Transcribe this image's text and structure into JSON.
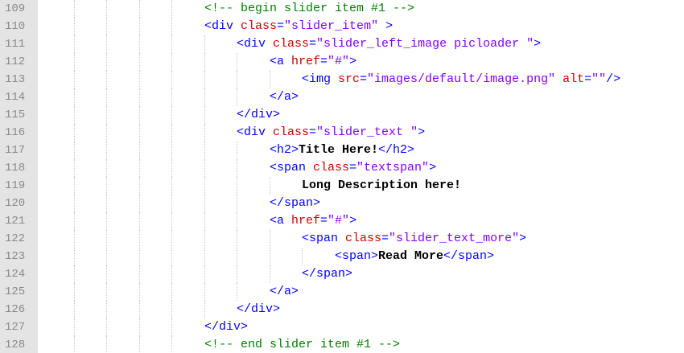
{
  "editor": {
    "language": "html",
    "colors": {
      "gutter_bg": "#e4e4e4",
      "line_number": "#8a8a8a",
      "comment": "#008000",
      "tag": "#0000ff",
      "attribute": "#cc0000",
      "string": "#8000ff",
      "text": "#000000",
      "indent_guide": "#c8c8c8"
    },
    "lines": [
      {
        "number": "109",
        "indent": 5,
        "tokens": [
          {
            "t": "comment",
            "v": "<!-- begin slider item #1 -->"
          }
        ]
      },
      {
        "number": "110",
        "indent": 5,
        "tokens": [
          {
            "t": "tag",
            "v": "<div "
          },
          {
            "t": "attr",
            "v": "class"
          },
          {
            "t": "tag",
            "v": "="
          },
          {
            "t": "str",
            "v": "\"slider_item\""
          },
          {
            "t": "tag",
            "v": " >"
          }
        ]
      },
      {
        "number": "111",
        "indent": 6,
        "tokens": [
          {
            "t": "tag",
            "v": "<div "
          },
          {
            "t": "attr",
            "v": "class"
          },
          {
            "t": "tag",
            "v": "="
          },
          {
            "t": "str",
            "v": "\"slider_left_image picloader \""
          },
          {
            "t": "tag",
            "v": ">"
          }
        ]
      },
      {
        "number": "112",
        "indent": 7,
        "tokens": [
          {
            "t": "tag",
            "v": "<a "
          },
          {
            "t": "attr",
            "v": "href"
          },
          {
            "t": "tag",
            "v": "="
          },
          {
            "t": "str",
            "v": "\"#\""
          },
          {
            "t": "tag",
            "v": ">"
          }
        ]
      },
      {
        "number": "113",
        "indent": 8,
        "tokens": [
          {
            "t": "tag",
            "v": "<img "
          },
          {
            "t": "attr",
            "v": "src"
          },
          {
            "t": "tag",
            "v": "="
          },
          {
            "t": "str",
            "v": "\"images/default/image.png\""
          },
          {
            "t": "tag",
            "v": " "
          },
          {
            "t": "attr",
            "v": "alt"
          },
          {
            "t": "tag",
            "v": "="
          },
          {
            "t": "str",
            "v": "\"\""
          },
          {
            "t": "tag",
            "v": "/>"
          }
        ]
      },
      {
        "number": "114",
        "indent": 7,
        "tokens": [
          {
            "t": "tag",
            "v": "</a>"
          }
        ]
      },
      {
        "number": "115",
        "indent": 6,
        "tokens": [
          {
            "t": "tag",
            "v": "</div>"
          }
        ]
      },
      {
        "number": "116",
        "indent": 6,
        "tokens": [
          {
            "t": "tag",
            "v": "<div "
          },
          {
            "t": "attr",
            "v": "class"
          },
          {
            "t": "tag",
            "v": "="
          },
          {
            "t": "str",
            "v": "\"slider_text \""
          },
          {
            "t": "tag",
            "v": ">"
          }
        ]
      },
      {
        "number": "117",
        "indent": 7,
        "tokens": [
          {
            "t": "tag",
            "v": "<h2>"
          },
          {
            "t": "text",
            "v": "Title Here!"
          },
          {
            "t": "tag",
            "v": "</h2>"
          }
        ]
      },
      {
        "number": "118",
        "indent": 7,
        "tokens": [
          {
            "t": "tag",
            "v": "<span "
          },
          {
            "t": "attr",
            "v": "class"
          },
          {
            "t": "tag",
            "v": "="
          },
          {
            "t": "str",
            "v": "\"textspan\""
          },
          {
            "t": "tag",
            "v": ">"
          }
        ]
      },
      {
        "number": "119",
        "indent": 8,
        "tokens": [
          {
            "t": "text",
            "v": "Long Description here!"
          }
        ]
      },
      {
        "number": "120",
        "indent": 7,
        "tokens": [
          {
            "t": "tag",
            "v": "</span>"
          }
        ]
      },
      {
        "number": "121",
        "indent": 7,
        "tokens": [
          {
            "t": "tag",
            "v": "<a "
          },
          {
            "t": "attr",
            "v": "href"
          },
          {
            "t": "tag",
            "v": "="
          },
          {
            "t": "str",
            "v": "\"#\""
          },
          {
            "t": "tag",
            "v": ">"
          }
        ]
      },
      {
        "number": "122",
        "indent": 8,
        "tokens": [
          {
            "t": "tag",
            "v": "<span "
          },
          {
            "t": "attr",
            "v": "class"
          },
          {
            "t": "tag",
            "v": "="
          },
          {
            "t": "str",
            "v": "\"slider_text_more\""
          },
          {
            "t": "tag",
            "v": ">"
          }
        ]
      },
      {
        "number": "123",
        "indent": 9,
        "tokens": [
          {
            "t": "tag",
            "v": "<span>"
          },
          {
            "t": "text",
            "v": "Read More"
          },
          {
            "t": "tag",
            "v": "</span>"
          }
        ]
      },
      {
        "number": "124",
        "indent": 8,
        "tokens": [
          {
            "t": "tag",
            "v": "</span>"
          }
        ]
      },
      {
        "number": "125",
        "indent": 7,
        "tokens": [
          {
            "t": "tag",
            "v": "</a>"
          }
        ]
      },
      {
        "number": "126",
        "indent": 6,
        "tokens": [
          {
            "t": "tag",
            "v": "</div>"
          }
        ]
      },
      {
        "number": "127",
        "indent": 5,
        "tokens": [
          {
            "t": "tag",
            "v": "</div>"
          }
        ]
      },
      {
        "number": "128",
        "indent": 5,
        "tokens": [
          {
            "t": "comment",
            "v": "<!-- end slider item #1 -->"
          }
        ]
      }
    ]
  }
}
